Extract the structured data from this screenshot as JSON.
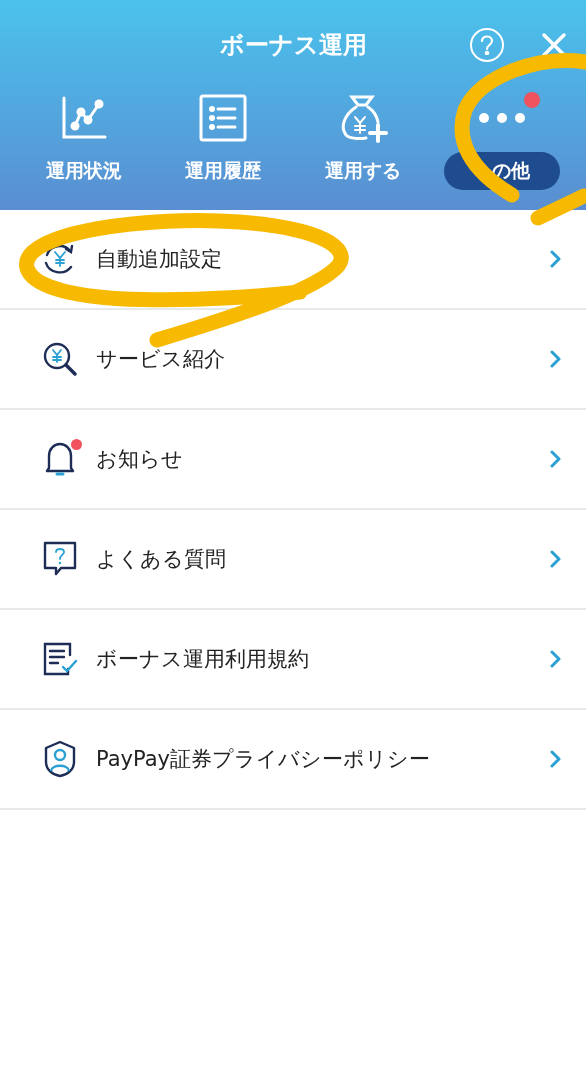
{
  "header": {
    "title": "ボーナス運用"
  },
  "tabs": [
    {
      "label": "運用状況",
      "selected": false,
      "badge": false
    },
    {
      "label": "運用履歴",
      "selected": false,
      "badge": false
    },
    {
      "label": "運用する",
      "selected": false,
      "badge": false
    },
    {
      "label": "の他",
      "selected": true,
      "badge": true
    }
  ],
  "menu": [
    {
      "label": "自動追加設定",
      "badge": false
    },
    {
      "label": "サービス紹介",
      "badge": false
    },
    {
      "label": "お知らせ",
      "badge": true
    },
    {
      "label": "よくある質問",
      "badge": false
    },
    {
      "label": "ボーナス運用利用規約",
      "badge": false
    },
    {
      "label": "PayPay証券プライバシーポリシー",
      "badge": false
    }
  ]
}
